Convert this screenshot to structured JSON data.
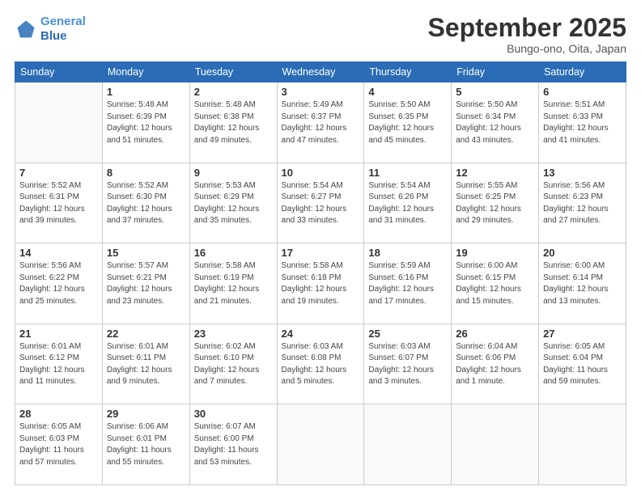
{
  "logo": {
    "line1": "General",
    "line2": "Blue"
  },
  "header": {
    "month_year": "September 2025",
    "location": "Bungo-ono, Oita, Japan"
  },
  "days_of_week": [
    "Sunday",
    "Monday",
    "Tuesday",
    "Wednesday",
    "Thursday",
    "Friday",
    "Saturday"
  ],
  "weeks": [
    [
      {
        "day": null
      },
      {
        "day": "1",
        "sunrise": "5:48 AM",
        "sunset": "6:39 PM",
        "daylight": "12 hours and 51 minutes."
      },
      {
        "day": "2",
        "sunrise": "5:48 AM",
        "sunset": "6:38 PM",
        "daylight": "12 hours and 49 minutes."
      },
      {
        "day": "3",
        "sunrise": "5:49 AM",
        "sunset": "6:37 PM",
        "daylight": "12 hours and 47 minutes."
      },
      {
        "day": "4",
        "sunrise": "5:50 AM",
        "sunset": "6:35 PM",
        "daylight": "12 hours and 45 minutes."
      },
      {
        "day": "5",
        "sunrise": "5:50 AM",
        "sunset": "6:34 PM",
        "daylight": "12 hours and 43 minutes."
      },
      {
        "day": "6",
        "sunrise": "5:51 AM",
        "sunset": "6:33 PM",
        "daylight": "12 hours and 41 minutes."
      }
    ],
    [
      {
        "day": "7",
        "sunrise": "5:52 AM",
        "sunset": "6:31 PM",
        "daylight": "12 hours and 39 minutes."
      },
      {
        "day": "8",
        "sunrise": "5:52 AM",
        "sunset": "6:30 PM",
        "daylight": "12 hours and 37 minutes."
      },
      {
        "day": "9",
        "sunrise": "5:53 AM",
        "sunset": "6:29 PM",
        "daylight": "12 hours and 35 minutes."
      },
      {
        "day": "10",
        "sunrise": "5:54 AM",
        "sunset": "6:27 PM",
        "daylight": "12 hours and 33 minutes."
      },
      {
        "day": "11",
        "sunrise": "5:54 AM",
        "sunset": "6:26 PM",
        "daylight": "12 hours and 31 minutes."
      },
      {
        "day": "12",
        "sunrise": "5:55 AM",
        "sunset": "6:25 PM",
        "daylight": "12 hours and 29 minutes."
      },
      {
        "day": "13",
        "sunrise": "5:56 AM",
        "sunset": "6:23 PM",
        "daylight": "12 hours and 27 minutes."
      }
    ],
    [
      {
        "day": "14",
        "sunrise": "5:56 AM",
        "sunset": "6:22 PM",
        "daylight": "12 hours and 25 minutes."
      },
      {
        "day": "15",
        "sunrise": "5:57 AM",
        "sunset": "6:21 PM",
        "daylight": "12 hours and 23 minutes."
      },
      {
        "day": "16",
        "sunrise": "5:58 AM",
        "sunset": "6:19 PM",
        "daylight": "12 hours and 21 minutes."
      },
      {
        "day": "17",
        "sunrise": "5:58 AM",
        "sunset": "6:18 PM",
        "daylight": "12 hours and 19 minutes."
      },
      {
        "day": "18",
        "sunrise": "5:59 AM",
        "sunset": "6:16 PM",
        "daylight": "12 hours and 17 minutes."
      },
      {
        "day": "19",
        "sunrise": "6:00 AM",
        "sunset": "6:15 PM",
        "daylight": "12 hours and 15 minutes."
      },
      {
        "day": "20",
        "sunrise": "6:00 AM",
        "sunset": "6:14 PM",
        "daylight": "12 hours and 13 minutes."
      }
    ],
    [
      {
        "day": "21",
        "sunrise": "6:01 AM",
        "sunset": "6:12 PM",
        "daylight": "12 hours and 11 minutes."
      },
      {
        "day": "22",
        "sunrise": "6:01 AM",
        "sunset": "6:11 PM",
        "daylight": "12 hours and 9 minutes."
      },
      {
        "day": "23",
        "sunrise": "6:02 AM",
        "sunset": "6:10 PM",
        "daylight": "12 hours and 7 minutes."
      },
      {
        "day": "24",
        "sunrise": "6:03 AM",
        "sunset": "6:08 PM",
        "daylight": "12 hours and 5 minutes."
      },
      {
        "day": "25",
        "sunrise": "6:03 AM",
        "sunset": "6:07 PM",
        "daylight": "12 hours and 3 minutes."
      },
      {
        "day": "26",
        "sunrise": "6:04 AM",
        "sunset": "6:06 PM",
        "daylight": "12 hours and 1 minute."
      },
      {
        "day": "27",
        "sunrise": "6:05 AM",
        "sunset": "6:04 PM",
        "daylight": "11 hours and 59 minutes."
      }
    ],
    [
      {
        "day": "28",
        "sunrise": "6:05 AM",
        "sunset": "6:03 PM",
        "daylight": "11 hours and 57 minutes."
      },
      {
        "day": "29",
        "sunrise": "6:06 AM",
        "sunset": "6:01 PM",
        "daylight": "11 hours and 55 minutes."
      },
      {
        "day": "30",
        "sunrise": "6:07 AM",
        "sunset": "6:00 PM",
        "daylight": "11 hours and 53 minutes."
      },
      {
        "day": null
      },
      {
        "day": null
      },
      {
        "day": null
      },
      {
        "day": null
      }
    ]
  ]
}
